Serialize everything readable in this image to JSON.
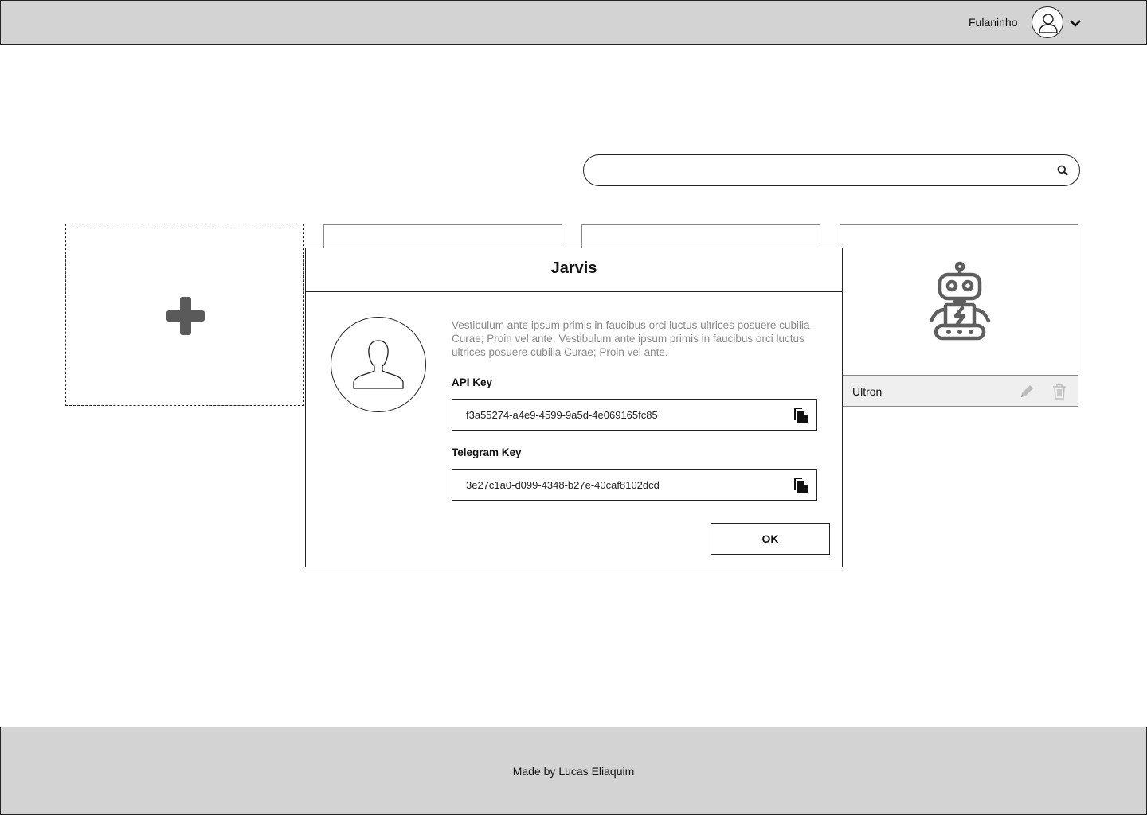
{
  "header": {
    "user_name": "Fulaninho",
    "avatar_icon": "user-icon",
    "menu_icon": "chevron-down-icon"
  },
  "search": {
    "placeholder": "",
    "icon": "search-icon"
  },
  "add_card": {
    "icon": "plus-icon"
  },
  "bots": [
    {
      "name": ""
    },
    {
      "name": ""
    },
    {
      "name": "Ultron",
      "icon": "robot-icon",
      "actions": [
        "edit-icon",
        "trash-icon"
      ]
    }
  ],
  "modal": {
    "title": "Jarvis",
    "avatar_icon": "user-silhouette-icon",
    "description": "Vestibulum ante ipsum primis in faucibus orci luctus  ultrices posuere cubilia Curae; Proin vel ante. Vestibulum ante ipsum primis in faucibus orci luctus  ultrices posuere cubilia Curae; Proin vel ante.",
    "api_key_label": "API Key",
    "api_key_value": "f3a55274-a4e9-4599-9a5d-4e069165fc85",
    "telegram_key_label": "Telegram Key",
    "telegram_key_value": "3e27c1a0-d099-4348-b27e-40caf8102dcd",
    "copy_icon": "copy-icon",
    "ok_label": "OK"
  },
  "footer": {
    "text": "Made by Lucas Eliaquim"
  }
}
